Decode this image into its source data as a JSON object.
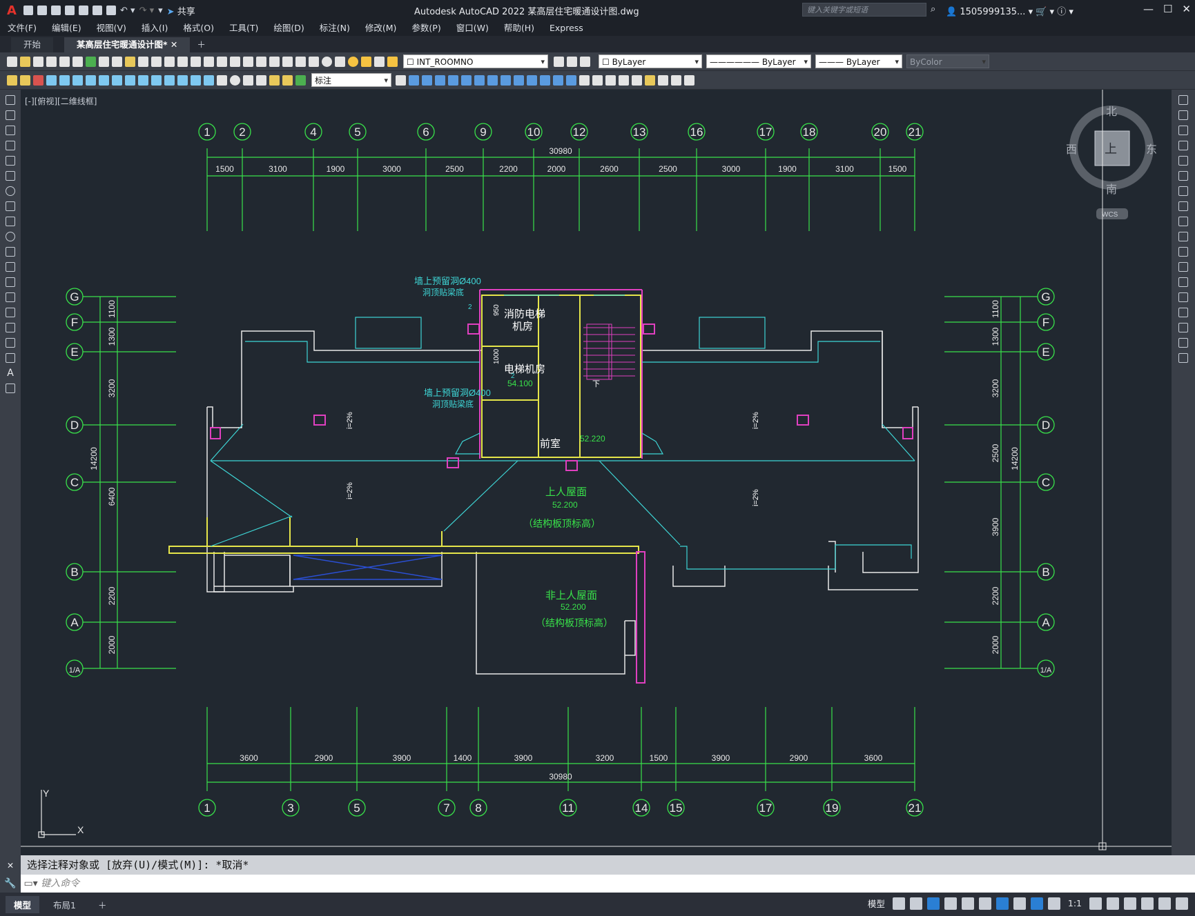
{
  "app": {
    "logo": "A",
    "title": "Autodesk AutoCAD 2022    某高层住宅暖通设计图.dwg",
    "search_placeholder": "键入关键字或短语",
    "user": "1505999135...",
    "share_label": "共享"
  },
  "menu": [
    "文件(F)",
    "编辑(E)",
    "视图(V)",
    "插入(I)",
    "格式(O)",
    "工具(T)",
    "绘图(D)",
    "标注(N)",
    "修改(M)",
    "参数(P)",
    "窗口(W)",
    "帮助(H)",
    "Express"
  ],
  "tabs": [
    {
      "label": "开始"
    },
    {
      "label": "某高层住宅暖通设计图*"
    }
  ],
  "toolbar": {
    "layer": "INT_ROOMNO",
    "color": "ByLayer",
    "linetype": "ByLayer",
    "lineweight": "ByLayer",
    "plotstyle": "ByColor",
    "dimstyle": "标注"
  },
  "viewport_label": "[-][俯视][二维线框]",
  "viewcube": {
    "north": "北",
    "south": "南",
    "east": "东",
    "west": "西",
    "top": "上",
    "wcs": "WCS"
  },
  "drawing": {
    "top_axes": [
      "1",
      "2",
      "4",
      "5",
      "6",
      "9",
      "10",
      "12",
      "13",
      "16",
      "17",
      "18",
      "20",
      "21"
    ],
    "top_dims": [
      "1500",
      "3100",
      "1900",
      "3000",
      "2500",
      "2200",
      "2000",
      "2600",
      "2500",
      "3000",
      "1900",
      "3100",
      "1500"
    ],
    "top_total": "30980",
    "bottom_axes": [
      "1",
      "3",
      "5",
      "7",
      "8",
      "11",
      "14",
      "15",
      "17",
      "19",
      "21"
    ],
    "bottom_dims": [
      "3600",
      "2900",
      "3900",
      "1400",
      "3900",
      "3200",
      "1500",
      "3900",
      "2900",
      "3600"
    ],
    "bottom_total": "30980",
    "side_axes": [
      "G",
      "F",
      "E",
      "D",
      "C",
      "B",
      "A",
      "1/A"
    ],
    "left_dims": [
      "1100",
      "1300",
      "3200",
      "6400",
      "2200",
      "2000"
    ],
    "left_total": "14200",
    "right_dims": [
      "1100",
      "1300",
      "3200",
      "2500",
      "3900",
      "2200",
      "2000"
    ],
    "right_total": "14200",
    "labels": {
      "vent_top": "墙上预留洞Ø400",
      "vent_top2": "洞顶贴梁底",
      "vent_mid": "墙上预留洞Ø400",
      "vent_mid2": "洞顶贴梁底",
      "fire_elev_room": "消防电梯",
      "fire_elev_room2": "机房",
      "elev_room": "电梯机房",
      "elev_level": "54.100",
      "lobby": "前室",
      "lobby_level": "52.220",
      "roof_up": "上人屋面",
      "roof_up_level": "52.200",
      "roof_up_note": "（结构板顶标高）",
      "roof_non": "非上人屋面",
      "roof_non_level": "52.200",
      "roof_non_note": "（结构板顶标高）",
      "slope": "i=2%",
      "down": "下",
      "dim_950": "950",
      "dim_1000": "1000",
      "vent_2": "2"
    },
    "ucs": {
      "x": "X",
      "y": "Y"
    }
  },
  "command": {
    "history": "选择注释对象或 [放弃(U)/模式(M)]: *取消*",
    "placeholder": "键入命令"
  },
  "status": {
    "layout_tabs": [
      "模型",
      "布局1"
    ],
    "model": "模型",
    "scale": "1:1"
  }
}
